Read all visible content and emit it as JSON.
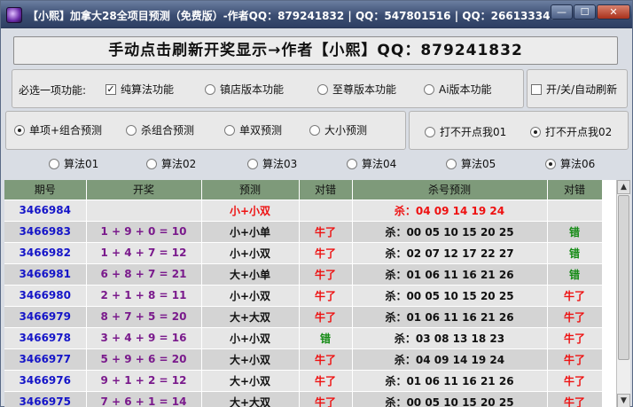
{
  "window": {
    "title": "【小熙】加拿大28全项目预测（免费版）-作者QQ：879241832 | QQ：547801516 | QQ：2661333471",
    "min_label": "—",
    "max_label": "☐",
    "close_label": "✕"
  },
  "banner": "手动点击刷新开奖显示→作者【小熙】QQ：879241832",
  "function_group": {
    "label": "必选一项功能:",
    "options": [
      {
        "label": "纯算法功能",
        "selected": true
      },
      {
        "label": "镇店版本功能",
        "selected": false
      },
      {
        "label": "至尊版本功能",
        "selected": false
      },
      {
        "label": "Ai版本功能",
        "selected": false
      }
    ],
    "auto_refresh_label": "开/关/自动刷新",
    "auto_refresh_checked": false
  },
  "predict_type": [
    {
      "label": "单项+组合预测",
      "selected": true
    },
    {
      "label": "杀组合预测",
      "selected": false
    },
    {
      "label": "单双预测",
      "selected": false
    },
    {
      "label": "大小预测",
      "selected": false
    }
  ],
  "click_options": [
    {
      "label": "打不开点我01",
      "selected": false
    },
    {
      "label": "打不开点我02",
      "selected": true
    }
  ],
  "algorithms": [
    {
      "label": "算法01",
      "selected": false
    },
    {
      "label": "算法02",
      "selected": false
    },
    {
      "label": "算法03",
      "selected": false
    },
    {
      "label": "算法04",
      "selected": false
    },
    {
      "label": "算法05",
      "selected": false
    },
    {
      "label": "算法06",
      "selected": true
    }
  ],
  "table": {
    "headers": [
      "期号",
      "开奖",
      "预测",
      "对错",
      "杀号预测",
      "对错"
    ],
    "rows": [
      {
        "period": "3466984",
        "draw": "",
        "prediction": "小+小双",
        "result": "",
        "kill": "杀：04 09 14 19 24",
        "kill_result": ""
      },
      {
        "period": "3466983",
        "draw": "1 + 9 + 0 = 10",
        "prediction": "小+小单",
        "result": "牛了",
        "kill": "杀：00 05 10 15 20 25",
        "kill_result": "错"
      },
      {
        "period": "3466982",
        "draw": "1 + 4 + 7 = 12",
        "prediction": "小+小双",
        "result": "牛了",
        "kill": "杀：02 07 12 17 22 27",
        "kill_result": "错"
      },
      {
        "period": "3466981",
        "draw": "6 + 8 + 7 = 21",
        "prediction": "大+小单",
        "result": "牛了",
        "kill": "杀：01 06 11 16 21 26",
        "kill_result": "错"
      },
      {
        "period": "3466980",
        "draw": "2 + 1 + 8 = 11",
        "prediction": "小+小双",
        "result": "牛了",
        "kill": "杀：00 05 10 15 20 25",
        "kill_result": "牛了"
      },
      {
        "period": "3466979",
        "draw": "8 + 7 + 5 = 20",
        "prediction": "大+大双",
        "result": "牛了",
        "kill": "杀：01 06 11 16 21 26",
        "kill_result": "牛了"
      },
      {
        "period": "3466978",
        "draw": "3 + 4 + 9 = 16",
        "prediction": "小+小双",
        "result": "错",
        "kill": "杀：03 08 13 18 23",
        "kill_result": "牛了"
      },
      {
        "period": "3466977",
        "draw": "5 + 9 + 6 = 20",
        "prediction": "大+小双",
        "result": "牛了",
        "kill": "杀：04 09 14 19 24",
        "kill_result": "牛了"
      },
      {
        "period": "3466976",
        "draw": "9 + 1 + 2 = 12",
        "prediction": "大+小双",
        "result": "牛了",
        "kill": "杀：01 06 11 16 21 26",
        "kill_result": "牛了"
      },
      {
        "period": "3466975",
        "draw": "7 + 6 + 1 = 14",
        "prediction": "大+大双",
        "result": "牛了",
        "kill": "杀：00 05 10 15 20 25",
        "kill_result": "牛了"
      }
    ]
  },
  "scrollbar": {
    "up": "▲",
    "down": "▼"
  },
  "colors": {
    "header_bg": "#7e9a7a",
    "period": "#1515c8",
    "draw": "#7a1a8c",
    "win": "#ee1111",
    "lose": "#138a13"
  }
}
